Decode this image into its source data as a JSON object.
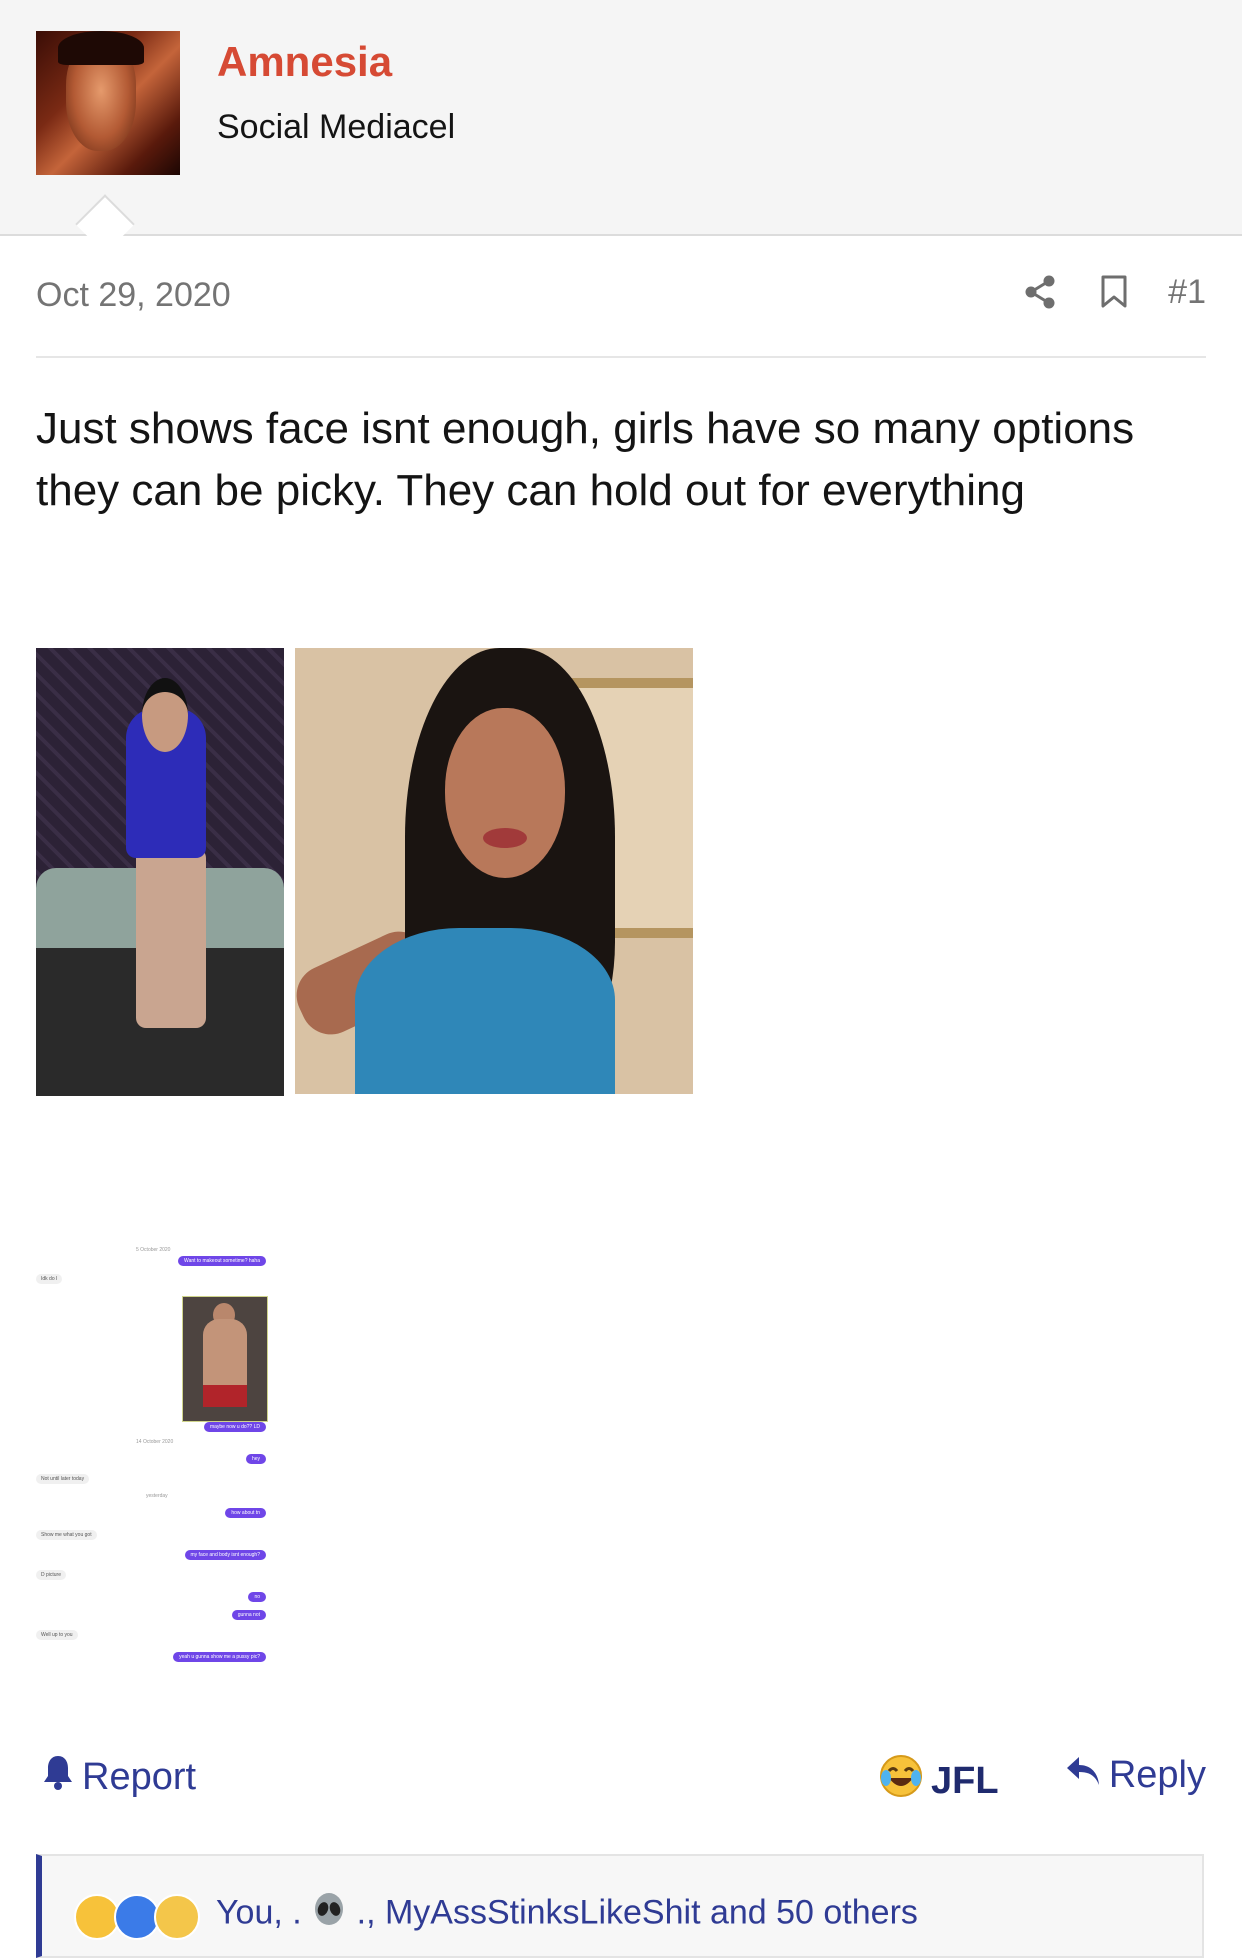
{
  "user": {
    "name": "Amnesia",
    "title": "Social Mediacel"
  },
  "post": {
    "date": "Oct 29, 2020",
    "number": "#1",
    "body": "Just shows face isnt enough, girls have so many options they can be picky. They can hold out for everything"
  },
  "chat_screenshot": {
    "messages": [
      {
        "type": "time",
        "text": "5 October 2020"
      },
      {
        "type": "sent",
        "text": "Want to makeout sometime? haha"
      },
      {
        "type": "recv",
        "text": "Idk do I"
      },
      {
        "type": "sent",
        "text": "maybe now u do?? LD"
      },
      {
        "type": "time",
        "text": "14 October 2020"
      },
      {
        "type": "sent",
        "text": "hey"
      },
      {
        "type": "recv",
        "text": "Not until later today"
      },
      {
        "type": "time",
        "text": "yesterday"
      },
      {
        "type": "sent",
        "text": "how about tn"
      },
      {
        "type": "recv",
        "text": "Show me what you got"
      },
      {
        "type": "sent",
        "text": "my face and body isnt enough?"
      },
      {
        "type": "recv",
        "text": "D picture"
      },
      {
        "type": "sent",
        "text": "no"
      },
      {
        "type": "sent",
        "text": "gunna not"
      },
      {
        "type": "recv",
        "text": "Well up to you"
      },
      {
        "type": "sent",
        "text": "yeah u gunna show me a pussy pic?"
      }
    ]
  },
  "actions": {
    "report": "Report",
    "jfl": "JFL",
    "reply": "Reply"
  },
  "reactions": {
    "text_you": "You, .",
    "text_rest": "., MyAssStinksLikeShit and 50 others"
  },
  "icons": {
    "share": "share-icon",
    "bookmark": "bookmark-icon",
    "report": "bell-icon",
    "jfl": "laughing-crying-emoji-icon",
    "reply": "reply-arrow-icon",
    "alien": "alien-emoji-icon"
  },
  "colors": {
    "username": "#d64a34",
    "link": "#2f3b94",
    "chat_bubble": "#6f46e8"
  }
}
